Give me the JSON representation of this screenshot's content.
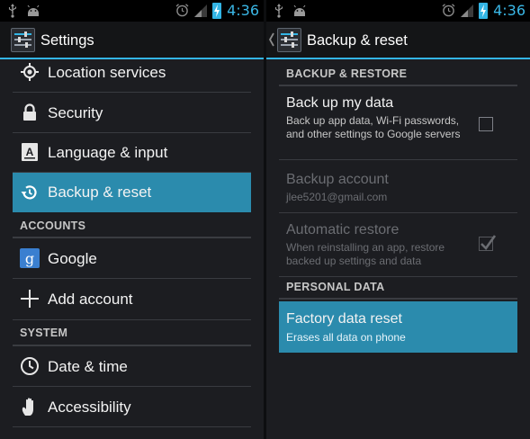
{
  "status_bar": {
    "time": "4:36",
    "icons": [
      "usb-icon",
      "android-icon",
      "alarm-icon",
      "signal-icon",
      "battery-charging-icon"
    ]
  },
  "colors": {
    "accent": "#33b5e5",
    "selected": "#2b8bad",
    "background": "#1c1d21"
  },
  "settings_screen": {
    "title": "Settings",
    "items_top": [
      {
        "label": "Location services",
        "icon": "location-icon"
      },
      {
        "label": "Security",
        "icon": "lock-icon"
      },
      {
        "label": "Language & input",
        "icon": "keyboard-icon"
      },
      {
        "label": "Backup & reset",
        "icon": "backup-icon",
        "selected": true
      }
    ],
    "accounts_header": "ACCOUNTS",
    "accounts_items": [
      {
        "label": "Google",
        "icon": "google-icon"
      },
      {
        "label": "Add account",
        "icon": "plus-icon"
      }
    ],
    "system_header": "SYSTEM",
    "system_items": [
      {
        "label": "Date & time",
        "icon": "clock-icon"
      },
      {
        "label": "Accessibility",
        "icon": "hand-icon"
      }
    ]
  },
  "backup_screen": {
    "title": "Backup & reset",
    "backup_header": "BACKUP & RESTORE",
    "back_up_data": {
      "title": "Back up my data",
      "summary": "Back up app data, Wi-Fi passwords, and other settings to Google servers",
      "checked": false
    },
    "backup_account": {
      "title": "Backup account",
      "summary": "jlee5201@gmail.com",
      "enabled": false
    },
    "automatic_restore": {
      "title": "Automatic restore",
      "summary": "When reinstalling an app, restore backed up settings and data",
      "checked": true,
      "enabled": false
    },
    "personal_header": "PERSONAL DATA",
    "factory_reset": {
      "title": "Factory data reset",
      "summary": "Erases all data on phone",
      "selected": true
    }
  }
}
